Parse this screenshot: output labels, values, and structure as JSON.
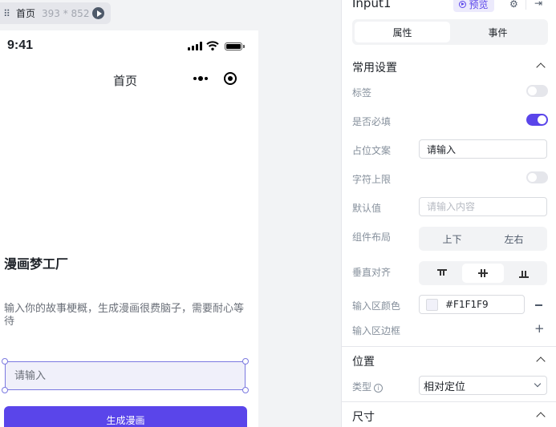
{
  "canvas": {
    "page_chip": {
      "name": "首页",
      "size": "393 * 852"
    },
    "phone": {
      "status_time": "9:41",
      "nav_title": "首页",
      "app_title": "漫画梦工厂",
      "app_desc": "输入你的故事梗概，生成漫画很费脑子，需要耐心等待",
      "input_placeholder": "请输入",
      "generate_button": "生成漫画"
    }
  },
  "panel": {
    "component_name": "Input1",
    "preview_label": "预览",
    "tabs": [
      "属性",
      "事件"
    ],
    "active_tab": "属性",
    "sections": {
      "common": {
        "title": "常用设置",
        "label_toggle": {
          "label": "标签",
          "on": false
        },
        "required_toggle": {
          "label": "是否必填",
          "on": true
        },
        "placeholder_field": {
          "label": "占位文案",
          "value": "请输入"
        },
        "maxlength_toggle": {
          "label": "字符上限",
          "on": false
        },
        "default_field": {
          "label": "默认值",
          "placeholder": "请输入内容"
        },
        "layout": {
          "label": "组件布局",
          "options": [
            "上下",
            "左右"
          ]
        },
        "valign": {
          "label": "垂直对齐",
          "options": [
            "top",
            "center",
            "bottom"
          ],
          "selected": "center"
        },
        "input_bg": {
          "label": "输入区颜色",
          "value": "#F1F1F9",
          "color": "#F1F1F9"
        },
        "input_border": {
          "label": "输入区边框"
        }
      },
      "position": {
        "title": "位置",
        "type": {
          "label": "类型",
          "value": "相对定位"
        }
      },
      "size": {
        "title": "尺寸"
      }
    }
  },
  "colors": {
    "accent": "#5A45EA",
    "selection": "#7B79E0"
  }
}
